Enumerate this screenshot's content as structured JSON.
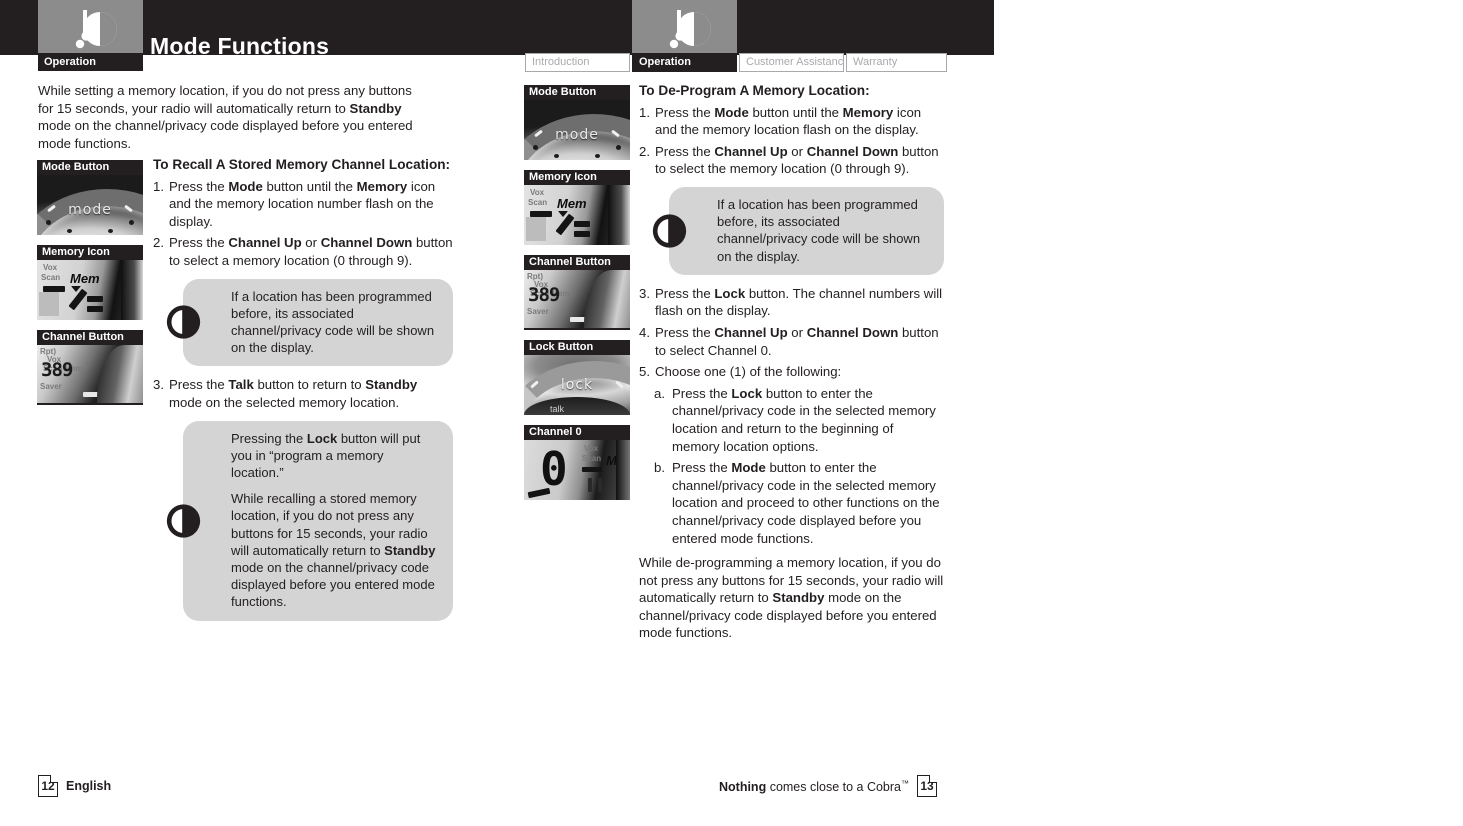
{
  "header": {
    "title": "Mode Functions",
    "section_label": "Operation",
    "logo_name": "cobra-radio-logo"
  },
  "tabs": [
    {
      "label": "Introduction",
      "active": false
    },
    {
      "label": "Operation",
      "active": true
    },
    {
      "label": "Customer Assistance",
      "active": false
    },
    {
      "label": "Warranty",
      "active": false
    }
  ],
  "left_page": {
    "intro": {
      "line1": "While setting a memory location, if you do not press any buttons",
      "line2_a": "for 15 seconds, your radio will automatically return to ",
      "line2_b": "Standby",
      "line3": "mode on the channel/privacy code displayed before you entered",
      "line4": "mode functions."
    },
    "thumbnails": [
      {
        "label": "Mode Button",
        "kind": "mode-dial"
      },
      {
        "label": "Memory Icon",
        "kind": "mem-lcd"
      },
      {
        "label": "Channel Button",
        "kind": "channel-dial"
      }
    ],
    "section_heading": "To Recall A Stored Memory Channel Location:",
    "steps": [
      {
        "num": "1.",
        "parts": [
          {
            "t": "Press the ",
            "b": false
          },
          {
            "t": "Mode",
            "b": true
          },
          {
            "t": " button until the ",
            "b": false
          },
          {
            "t": "Memory",
            "b": true
          },
          {
            "t": " icon and the memory location number flash on the display.",
            "b": false
          }
        ]
      },
      {
        "num": "2.",
        "parts": [
          {
            "t": "Press the ",
            "b": false
          },
          {
            "t": "Channel Up",
            "b": true
          },
          {
            "t": " or ",
            "b": false
          },
          {
            "t": "Channel Down",
            "b": true
          },
          {
            "t": " button to select a memory location (0 through 9).",
            "b": false
          }
        ]
      },
      {
        "num": "3.",
        "parts": [
          {
            "t": "Press the ",
            "b": false
          },
          {
            "t": "Talk",
            "b": true
          },
          {
            "t": " button to return to ",
            "b": false
          },
          {
            "t": "Standby",
            "b": true
          },
          {
            "t": " mode on the selected memory location.",
            "b": false
          }
        ]
      }
    ],
    "callout_1": {
      "icon": "info-power-icon",
      "paragraphs": [
        "If a location has been programmed before, its associated channel/privacy code will be shown on the display."
      ]
    },
    "callout_2": {
      "icon": "info-power-icon",
      "p1_a": "Pressing the ",
      "p1_b": "Lock",
      "p1_c": " button will put you in “program a memory location.”",
      "p2_a": "While recalling a stored memory location, if you do not press any buttons for 15 seconds, your radio will automatically return to ",
      "p2_b": "Standby",
      "p2_c": " mode on the channel/privacy code displayed before you entered mode functions."
    }
  },
  "right_page": {
    "thumbnails": [
      {
        "label": "Mode Button",
        "kind": "mode-dial"
      },
      {
        "label": "Memory Icon",
        "kind": "mem-lcd"
      },
      {
        "label": "Channel Button",
        "kind": "channel-dial"
      },
      {
        "label": "Lock Button",
        "kind": "lock-dial"
      },
      {
        "label": "Channel 0",
        "kind": "channel0-lcd"
      }
    ],
    "section_heading": "To De-Program A Memory Location:",
    "steps": [
      {
        "num": "1.",
        "parts": [
          {
            "t": "Press the ",
            "b": false
          },
          {
            "t": "Mode",
            "b": true
          },
          {
            "t": " button until the ",
            "b": false
          },
          {
            "t": "Memory",
            "b": true
          },
          {
            "t": " icon and the memory location flash on the display.",
            "b": false
          }
        ]
      },
      {
        "num": "2.",
        "parts": [
          {
            "t": "Press the ",
            "b": false
          },
          {
            "t": "Channel Up",
            "b": true
          },
          {
            "t": " or ",
            "b": false
          },
          {
            "t": "Channel Down",
            "b": true
          },
          {
            "t": " button to select the memory location (0 through 9).",
            "b": false
          }
        ]
      },
      {
        "num": "3.",
        "parts": [
          {
            "t": "Press the ",
            "b": false
          },
          {
            "t": "Lock",
            "b": true
          },
          {
            "t": " button. The channel numbers will flash on the display.",
            "b": false
          }
        ]
      },
      {
        "num": "4.",
        "parts": [
          {
            "t": "Press the ",
            "b": false
          },
          {
            "t": "Channel Up",
            "b": true
          },
          {
            "t": " or ",
            "b": false
          },
          {
            "t": "Channel Down",
            "b": true
          },
          {
            "t": " button to select Channel 0.",
            "b": false
          }
        ]
      },
      {
        "num": "5.",
        "parts": [
          {
            "t": "Choose one (1) of the following:",
            "b": false
          }
        ]
      }
    ],
    "substeps": [
      {
        "num": "a.",
        "parts": [
          {
            "t": "Press the ",
            "b": false
          },
          {
            "t": "Lock",
            "b": true
          },
          {
            "t": " button to enter the channel/privacy code in the selected memory location and return to the beginning of memory location options.",
            "b": false
          }
        ]
      },
      {
        "num": "b.",
        "parts": [
          {
            "t": "Press the ",
            "b": false
          },
          {
            "t": "Mode",
            "b": true
          },
          {
            "t": " button to enter the channel/privacy code in the selected memory location and proceed to other functions on the channel/privacy code displayed before you entered mode functions.",
            "b": false
          }
        ]
      }
    ],
    "callout_1": {
      "icon": "info-power-icon",
      "paragraphs": [
        "If a location has been programmed before, its associated channel/privacy code will be shown on the display."
      ]
    },
    "closing": {
      "a": "While de-programming a memory location, if you do not press any buttons for 15 seconds, your radio will automatically return to ",
      "b": "Standby",
      "c": " mode on the channel/privacy code displayed before you entered mode functions."
    }
  },
  "footer": {
    "left_page_number": "12",
    "left_language": "English",
    "right_slogan_bold": "Nothing",
    "right_slogan_rest": " comes close to a Cobra",
    "right_trademark": "™",
    "right_page_number": "13"
  },
  "colors": {
    "black": "#231f20",
    "gray_logo_box": "#8c8c8c",
    "callout_gray": "#d4d4d4",
    "tab_inactive_text": "#a7a9ac"
  }
}
